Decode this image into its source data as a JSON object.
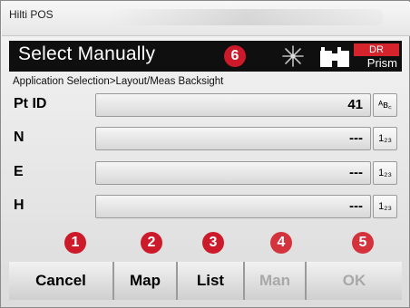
{
  "window": {
    "app_title": "Hilti POS"
  },
  "header": {
    "title": "Select Manually",
    "badge": "6",
    "mode_top": "DR",
    "mode_bottom": "Prism",
    "accent_color": "#d6242c"
  },
  "breadcrumb": "Application Selection>Layout/Meas Backsight",
  "fields": [
    {
      "label": "Pt ID",
      "value": "41",
      "format": "ᴬʙ꜀"
    },
    {
      "label": "N",
      "value": "---",
      "format": "1₂₃"
    },
    {
      "label": "E",
      "value": "---",
      "format": "1₂₃"
    },
    {
      "label": "H",
      "value": "---",
      "format": "1₂₃"
    }
  ],
  "softkeys": [
    {
      "label": "Cancel",
      "badge": "1",
      "enabled": true
    },
    {
      "label": "Map",
      "badge": "2",
      "enabled": true
    },
    {
      "label": "List",
      "badge": "3",
      "enabled": true
    },
    {
      "label": "Man",
      "badge": "4",
      "enabled": false
    },
    {
      "label": "OK",
      "badge": "5",
      "enabled": false
    }
  ]
}
